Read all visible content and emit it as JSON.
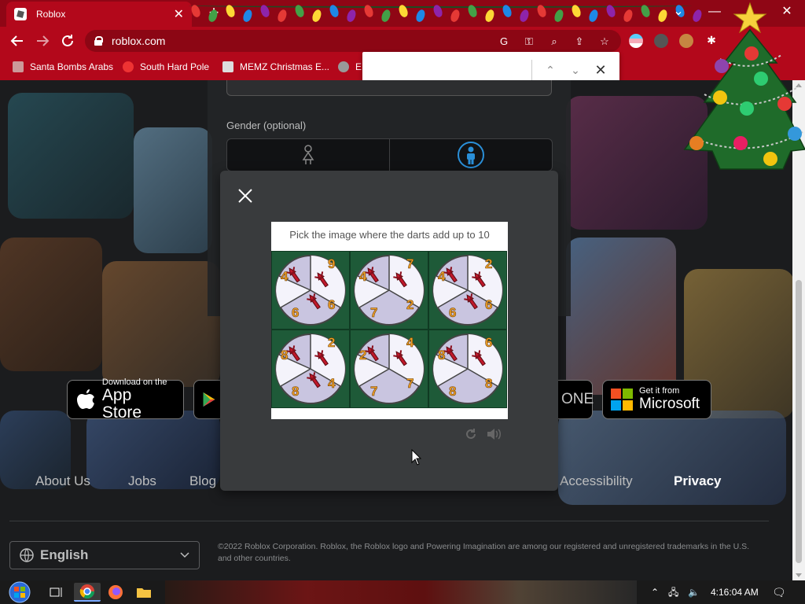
{
  "browser": {
    "tab_title": "Roblox",
    "url": "roblox.com",
    "bookmarks": [
      "Santa Bombs Arabs",
      "South Hard Pole",
      "MEMZ Christmas E...",
      "E"
    ]
  },
  "page": {
    "gender_label": "Gender (optional)",
    "app_store": {
      "small": "Download on the",
      "big": "App Store"
    },
    "xbox_partial": "ONE",
    "microsoft": {
      "small": "Get it from",
      "big": "Microsoft"
    },
    "footer_links": [
      "About Us",
      "Jobs",
      "Blog",
      "Accessibility",
      "Privacy"
    ],
    "language": "English",
    "copyright": "©2022 Roblox Corporation. Roblox, the Roblox logo and Powering Imagination are among our registered and unregistered trademarks in the U.S. and other countries."
  },
  "captcha": {
    "prompt": "Pick the image where the darts add up to 10",
    "tiles": [
      {
        "numbers": [
          "4",
          "9",
          "6",
          "6"
        ],
        "darts": 3
      },
      {
        "numbers": [
          "4",
          "7",
          "2",
          "7"
        ],
        "darts": 2
      },
      {
        "numbers": [
          "4",
          "2",
          "6",
          "6"
        ],
        "darts": 3
      },
      {
        "numbers": [
          "8",
          "2",
          "4",
          "8"
        ],
        "darts": 3
      },
      {
        "numbers": [
          "2",
          "4",
          "7",
          "7"
        ],
        "darts": 2
      },
      {
        "numbers": [
          "8",
          "6",
          "8",
          "8"
        ],
        "darts": 2
      }
    ]
  },
  "taskbar": {
    "time": "4:16:04 AM"
  },
  "icons": {
    "tab_favicon": "roblox-icon",
    "back": "arrow-left-icon",
    "forward": "arrow-right-icon",
    "reload": "reload-icon",
    "modal_close": "close-icon",
    "refresh": "refresh-icon",
    "audio": "speaker-icon"
  },
  "colors": {
    "chrome_red": "#b3081b",
    "page_bg": "#1b1c1e",
    "modal_bg": "#393b3d",
    "captcha_green": "#1e5a38",
    "number_orange": "#f3a32a"
  }
}
